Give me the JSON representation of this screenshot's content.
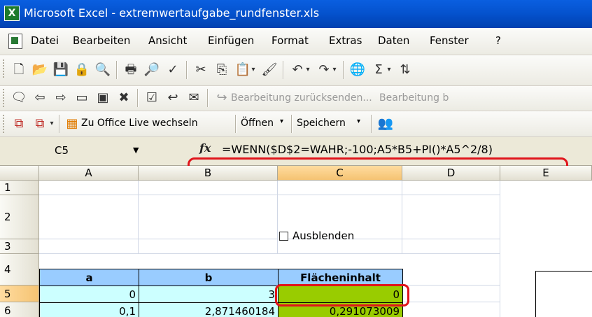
{
  "window": {
    "title": "Microsoft Excel - extremwertaufgabe_rundfenster.xls",
    "app_icon": "X"
  },
  "menu": [
    "Datei",
    "Bearbeiten",
    "Ansicht",
    "Einfügen",
    "Format",
    "Extras",
    "Daten",
    "Fenster",
    "?"
  ],
  "toolbar_review": {
    "send_back_label": "Bearbeitung zurücksenden...",
    "end_review_label": "Bearbeitung b"
  },
  "toolbar_live": {
    "switch_label": "Zu Office Live wechseln",
    "open_label": "Öffnen",
    "save_label": "Speichern"
  },
  "formula_bar": {
    "name_box": "C5",
    "fx": "fx",
    "formula": "=WENN($D$2=WAHR;-100;A5*B5+PI()*A5^2/8)"
  },
  "sheet": {
    "columns": [
      "A",
      "B",
      "C",
      "D",
      "E"
    ],
    "rows": [
      "1",
      "2",
      "3",
      "4",
      "5",
      "6"
    ],
    "checkbox_label": "Ausblenden",
    "headers": {
      "a": "a",
      "b": "b",
      "c": "Flächeninhalt"
    },
    "row5": {
      "a": "0",
      "b": "3",
      "c": "0"
    },
    "row6": {
      "a": "0,1",
      "b": "2,871460184",
      "c": "0,291073009"
    }
  },
  "colors": {
    "header_fill": "#99ccff",
    "input_fill": "#ccffff",
    "result_fill": "#99cc00",
    "highlight": "#e0141b"
  }
}
